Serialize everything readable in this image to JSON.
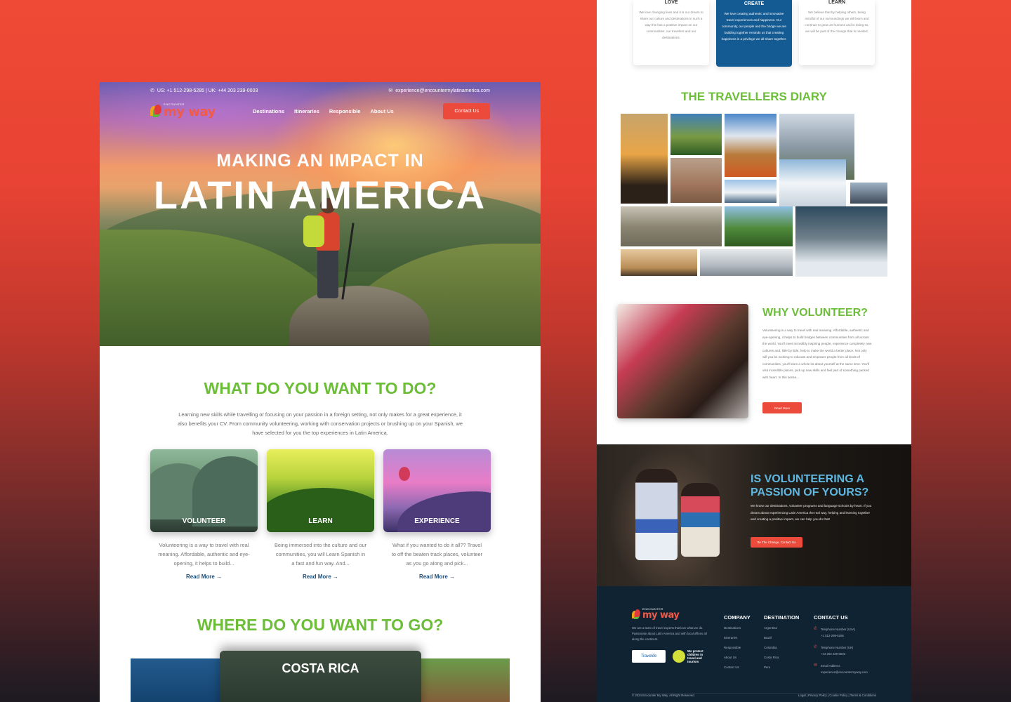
{
  "left": {
    "topbar": {
      "phone": "US: +1 512-298-5285 | UK: +44 203 239-0003",
      "email": "experience@encountermylatinamerica.com"
    },
    "logo": {
      "small": "ENCOUNTER",
      "big": "my way"
    },
    "nav": [
      "Destinations",
      "Itineraries",
      "Responsible",
      "About Us"
    ],
    "contact_button": "Contact Us",
    "hero": {
      "line1": "MAKING AN IMPACT IN",
      "line2": "LATIN AMERICA"
    },
    "what": {
      "title": "WHAT DO YOU WANT TO DO?",
      "desc": "Learning new skills while travelling or focusing on your passion in a foreign setting, not only makes for a great experience, it also benefits your CV. From community volunteering, working with conservation projects or brushing up on your Spanish, we have selected for you the top experiences in Latin America."
    },
    "cards": [
      {
        "label": "VOLUNTEER",
        "text": "Volunteering is a way to travel with real meaning. Affordable, authentic and eye-opening, it helps to build...",
        "more": "Read More →"
      },
      {
        "label": "LEARN",
        "text": "Being immersed into the culture and our communities, you will Learn Spanish in a fast and fun way. And...",
        "more": "Read More →"
      },
      {
        "label": "EXPERIENCE",
        "text": "What if you wanted to do it all?? Travel to off the beaten track places, volunteer as you go along and pick...",
        "more": "Read More →"
      }
    ],
    "where": {
      "title": "WHERE DO YOU WANT TO GO?",
      "featured": "COSTA RICA"
    }
  },
  "right": {
    "values": [
      {
        "title": "LOVE",
        "text": "We love changing lives and it is our dream to share our culture and destinations in such a way this has a positive impact on our communities, our travelers and our destinations."
      },
      {
        "title": "CREATE",
        "text": "We love creating authentic and innovative travel experiences and happiness. Our community, our people and the bridge we are building together reminds us that creating happiness is a privilege we all share together."
      },
      {
        "title": "LEARN",
        "text": "We believe that by helping others, being mindful of our surroundings we will learn and continue to grow as humans and in doing so, we will be part of the change that is needed."
      }
    ],
    "diary_title": "THE TRAVELLERS DIARY",
    "why": {
      "title": "WHY VOLUNTEER?",
      "text": "Volunteering is a way to travel with real meaning. Affordable, authentic and eye-opening, it helps to build bridges between communities from all across the world. You'll meet incredibly inspiring people, experience completely new cultures and, little by little, help to make the world a better place. Not only will you be working to educate and empower people from all kinds of communities, you'll learn a whole lot about yourself at the same time. You'll visit incredible places, pick up new skills and feel part of something packed with heart. In this sense...",
      "button": "Read More"
    },
    "passion": {
      "title": "IS VOLUNTEERING A PASSION OF YOURS?",
      "text": "We know our destinations, volunteer programs and language schools by heart. If you dream about experiencing Latin America the real way, helping and learning together and creating a positive impact, we can help you do that!",
      "button": "Be The Change, Contact Us"
    },
    "footer": {
      "logo_small": "ENCOUNTER",
      "logo_big": "my way",
      "about": "We are a team of travel experts that love what we do. Passionate about Latin America and with local offices all along the continent.",
      "badge1": "Travelife",
      "badge2": "We protect children in travel and tourism",
      "company_title": "COMPANY",
      "company": [
        "Destinations",
        "Itineraries",
        "Responsible",
        "About Us",
        "Contact Us"
      ],
      "destination_title": "DESTINATION",
      "destinations": [
        "Argentina",
        "Brazil",
        "Colombia",
        "Costa Rica",
        "Peru"
      ],
      "contact_title": "CONTACT US",
      "contact": [
        {
          "label": "Telephone Number (USA)",
          "value": "+1 512-298-5285"
        },
        {
          "label": "Telephone Number (UK)",
          "value": "+44 203 239-0003"
        },
        {
          "label": "Email Address",
          "value": "experience@encountermyway.com"
        }
      ],
      "copyright": "© 2024 Encounter My Way. All Right Reserved.",
      "legal": "Legal | Privacy Policy | Cookie Policy | Terms & Conditions"
    }
  },
  "colors": {
    "brand_red": "#ec4a3a",
    "brand_green": "#6cbd38",
    "brand_blue": "#145a93",
    "footer_bg": "#0f2333"
  }
}
